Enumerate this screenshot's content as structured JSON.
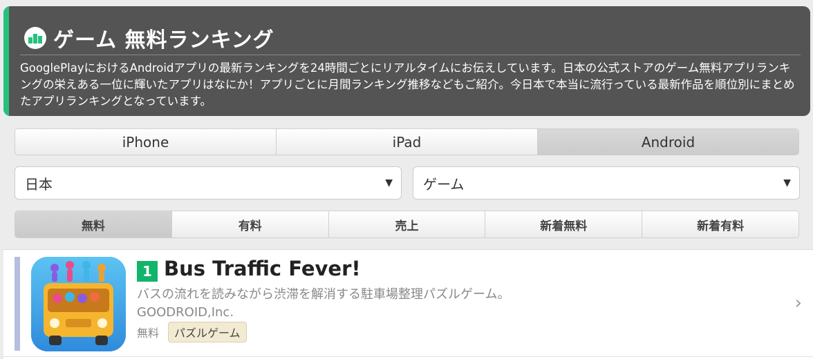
{
  "header": {
    "title": "ゲーム 無料ランキング",
    "description": "GooglePlayにおけるAndroidアプリの最新ランキングを24時間ごとにリアルタイムにお伝えしています。日本の公式ストアのゲーム無料アプリランキングの栄えある一位に輝いたアプリはなにか！アプリごとに月間ランキング推移などもご紹介。今日本で本当に流行っている最新作品を順位別にまとめたアプリランキングとなっています。",
    "accent_color": "#27c07d"
  },
  "device_tabs": [
    {
      "label": "iPhone",
      "active": false
    },
    {
      "label": "iPad",
      "active": false
    },
    {
      "label": "Android",
      "active": true
    }
  ],
  "filters": {
    "country": "日本",
    "category": "ゲーム"
  },
  "price_tabs": [
    {
      "label": "無料",
      "active": true
    },
    {
      "label": "有料",
      "active": false
    },
    {
      "label": "売上",
      "active": false
    },
    {
      "label": "新着無料",
      "active": false
    },
    {
      "label": "新着有料",
      "active": false
    }
  ],
  "ranking": [
    {
      "rank": "1",
      "name": "Bus Traffic Fever!",
      "description": "バスの流れを読みながら渋滞を解消する駐車場整理パズルゲーム。",
      "developer": "GOODROID,Inc.",
      "price": "無料",
      "genre": "パズルゲーム",
      "rank_color": "#12b46a"
    }
  ]
}
